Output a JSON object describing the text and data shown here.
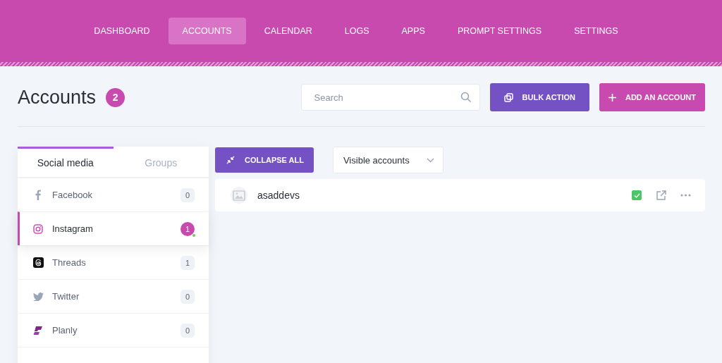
{
  "nav": [
    {
      "label": "DASHBOARD",
      "selected": false
    },
    {
      "label": "ACCOUNTS",
      "selected": true
    },
    {
      "label": "CALENDAR",
      "selected": false
    },
    {
      "label": "LOGS",
      "selected": false
    },
    {
      "label": "APPS",
      "selected": false
    },
    {
      "label": "PROMPT SETTINGS",
      "selected": false
    },
    {
      "label": "SETTINGS",
      "selected": false
    }
  ],
  "header": {
    "title": "Accounts",
    "count": "2",
    "search": {
      "placeholder": "Search"
    },
    "buttons": [
      {
        "kind": "bulk",
        "label": "BULK ACTION"
      },
      {
        "kind": "add",
        "label": "ADD AN ACCOUNT"
      }
    ]
  },
  "sidebar": {
    "tabs": [
      {
        "label": "Social media",
        "selected": true
      },
      {
        "label": "Groups",
        "selected": false
      }
    ],
    "items": [
      {
        "kind": "facebook",
        "label": "Facebook",
        "count": "0",
        "selected": false
      },
      {
        "kind": "instagram",
        "label": "Instagram",
        "count": "1",
        "selected": true
      },
      {
        "kind": "threads",
        "label": "Threads",
        "count": "1",
        "selected": false
      },
      {
        "kind": "twitter",
        "label": "Twitter",
        "count": "0",
        "selected": false
      },
      {
        "kind": "planly",
        "label": "Planly",
        "count": "0",
        "selected": false
      }
    ]
  },
  "toolbar": {
    "collapse_label": "COLLAPSE ALL",
    "filter": "Visible accounts"
  },
  "accounts": [
    {
      "name": "asaddevs",
      "active": true
    }
  ]
}
